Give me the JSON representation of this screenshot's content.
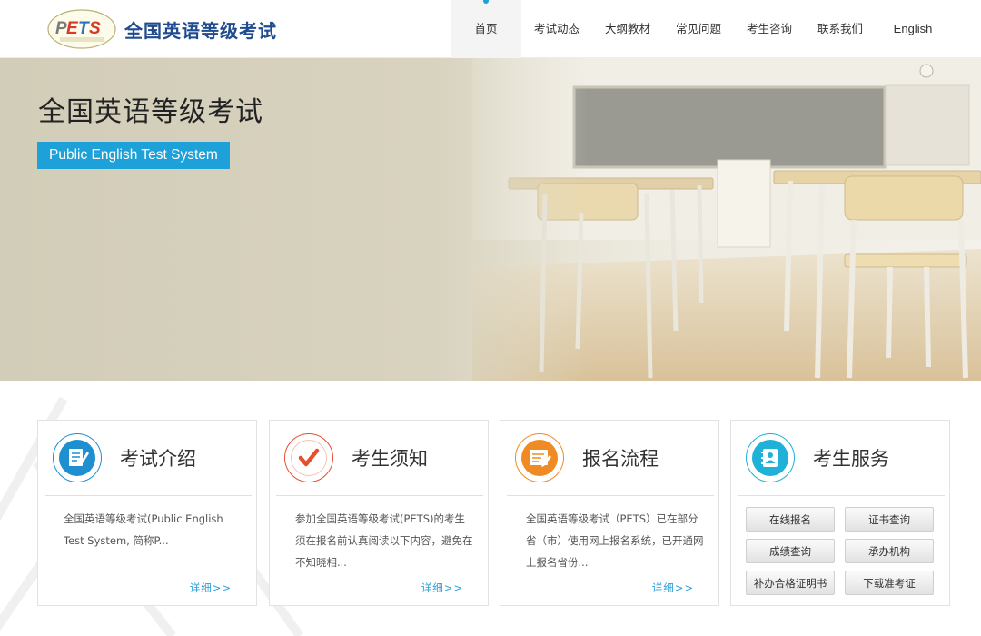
{
  "header": {
    "site_title": "全国英语等级考试",
    "logo_text": "PETS",
    "logo_subtext": "全国英语等级考试"
  },
  "nav": {
    "items": [
      {
        "label": "首页",
        "active": true
      },
      {
        "label": "考试动态",
        "active": false
      },
      {
        "label": "大纲教材",
        "active": false
      },
      {
        "label": "常见问题",
        "active": false
      },
      {
        "label": "考生咨询",
        "active": false
      },
      {
        "label": "联系我们",
        "active": false
      },
      {
        "label": "English",
        "active": false
      }
    ]
  },
  "banner": {
    "title": "全国英语等级考试",
    "subtitle": "Public English Test System"
  },
  "cards": [
    {
      "title": "考试介绍",
      "icon": "document-pen-icon",
      "text": "全国英语等级考试(Public English Test System, 简称P...",
      "more": "详细>>"
    },
    {
      "title": "考生须知",
      "icon": "checkmark-icon",
      "text": "参加全国英语等级考试(PETS)的考生须在报名前认真阅读以下内容，避免在不知晓相...",
      "more": "详细>>"
    },
    {
      "title": "报名流程",
      "icon": "form-edit-icon",
      "text": "全国英语等级考试（PETS）已在部分省（市）使用网上报名系统，已开通网上报名省份...",
      "more": "详细>>"
    },
    {
      "title": "考生服务",
      "icon": "contact-book-icon",
      "buttons": [
        "在线报名",
        "证书查询",
        "成绩查询",
        "承办机构",
        "补办合格证明书",
        "下载准考证"
      ]
    }
  ],
  "colors": {
    "accent": "#1da1d8",
    "title_blue": "#1f4b8f",
    "icon_blue": "#1f8fd0",
    "icon_red": "#e4502e",
    "icon_orange": "#f08a24",
    "icon_cyan": "#1fb1d8"
  }
}
